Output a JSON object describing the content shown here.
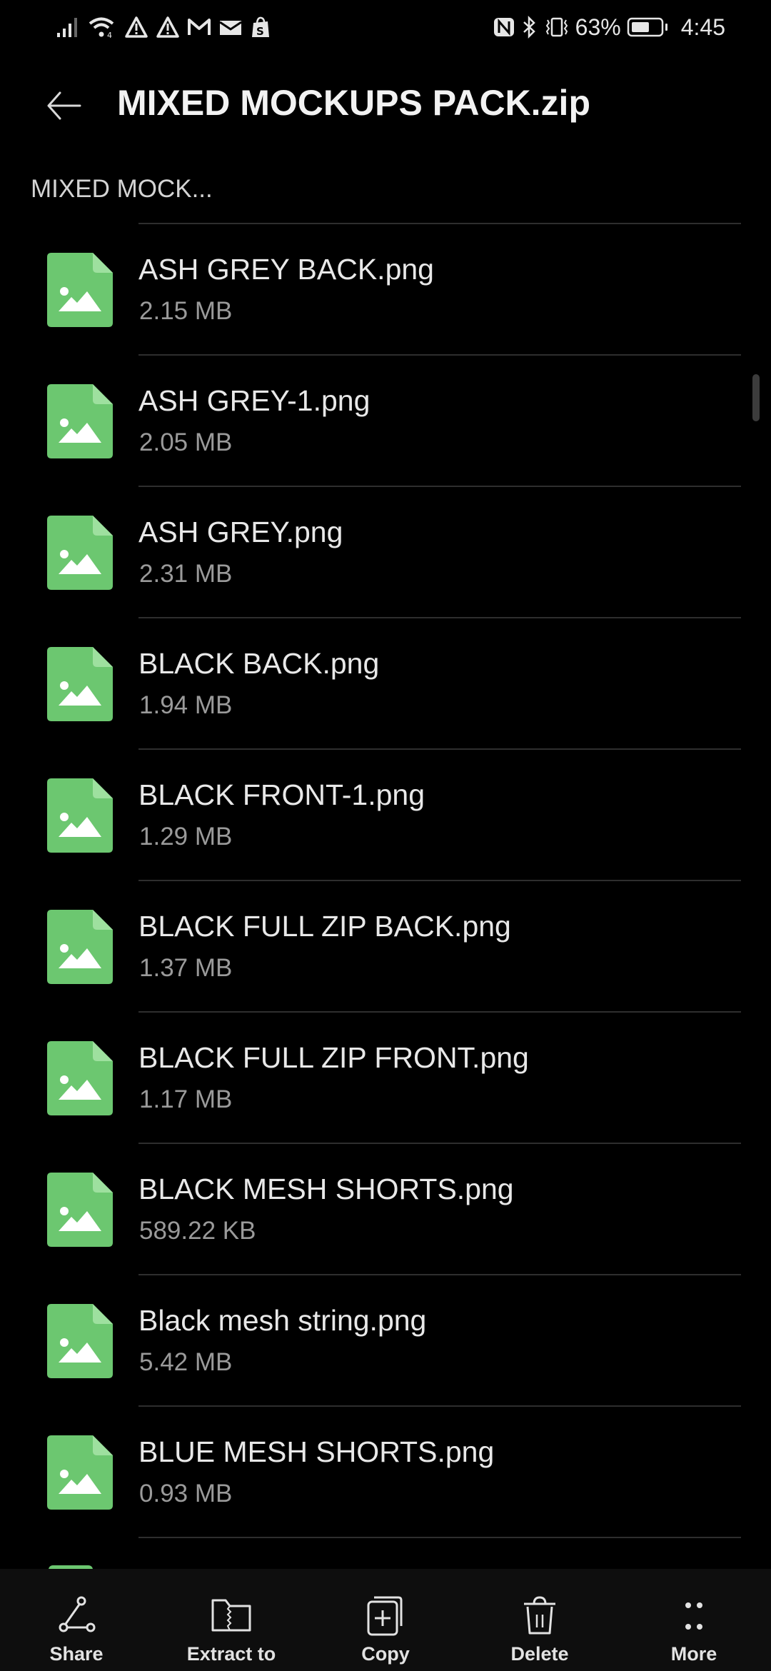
{
  "status_bar": {
    "left_icons": [
      "signal-icon",
      "wifi-icon",
      "warning-icon",
      "warning-icon",
      "gmail-icon",
      "mail-icon",
      "shopify-icon"
    ],
    "right_icons": [
      "nfc-icon",
      "bluetooth-icon",
      "vibrate-icon"
    ],
    "battery_percent": "63%",
    "battery_level": 0.63,
    "time": "4:45"
  },
  "header": {
    "back_icon": "arrow-left-icon",
    "title": "MIXED MOCKUPS PACK.zip"
  },
  "breadcrumb": "MIXED MOCK...",
  "colors": {
    "file_icon": "#6cc770",
    "background": "#000000",
    "bottom_bar": "#0e0e0e"
  },
  "files": [
    {
      "name": "ASH GREY BACK.png",
      "size": "2.15 MB",
      "icon": "image-file-icon"
    },
    {
      "name": "ASH GREY-1.png",
      "size": "2.05 MB",
      "icon": "image-file-icon"
    },
    {
      "name": "ASH GREY.png",
      "size": "2.31 MB",
      "icon": "image-file-icon"
    },
    {
      "name": "BLACK BACK.png",
      "size": "1.94 MB",
      "icon": "image-file-icon"
    },
    {
      "name": "BLACK FRONT-1.png",
      "size": "1.29 MB",
      "icon": "image-file-icon"
    },
    {
      "name": "BLACK FULL ZIP BACK.png",
      "size": "1.37 MB",
      "icon": "image-file-icon"
    },
    {
      "name": "BLACK FULL ZIP FRONT.png",
      "size": "1.17 MB",
      "icon": "image-file-icon"
    },
    {
      "name": "BLACK MESH SHORTS.png",
      "size": "589.22 KB",
      "icon": "image-file-icon"
    },
    {
      "name": "Black mesh string.png",
      "size": "5.42 MB",
      "icon": "image-file-icon"
    },
    {
      "name": "BLUE MESH SHORTS.png",
      "size": "0.93 MB",
      "icon": "image-file-icon"
    }
  ],
  "bottom_actions": [
    {
      "label": "Share",
      "icon": "share-icon"
    },
    {
      "label": "Extract to",
      "icon": "extract-folder-icon"
    },
    {
      "label": "Copy",
      "icon": "copy-icon"
    },
    {
      "label": "Delete",
      "icon": "trash-icon"
    },
    {
      "label": "More",
      "icon": "more-dots-icon"
    }
  ]
}
